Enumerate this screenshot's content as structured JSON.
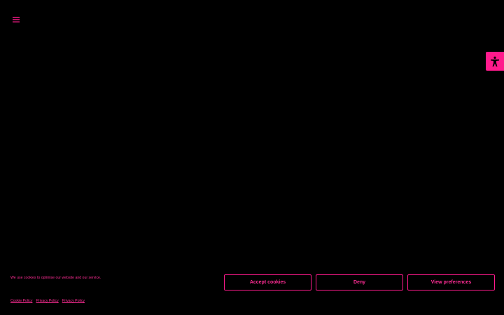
{
  "colors": {
    "background": "#000000",
    "accent": "#ff1a8c",
    "text": "#ff2d95"
  },
  "header": {
    "menu_icon": "hamburger-menu-icon"
  },
  "accessibility": {
    "icon": "accessibility-person-icon"
  },
  "cookie_banner": {
    "message": "We use cookies to optimise our website and our service.",
    "links": [
      {
        "label": "Cookie Policy"
      },
      {
        "label": "Privacy Policy"
      },
      {
        "label": "Privacy Policy"
      }
    ],
    "buttons": {
      "accept": "Accept cookies",
      "deny": "Deny",
      "preferences": "View preferences"
    }
  }
}
